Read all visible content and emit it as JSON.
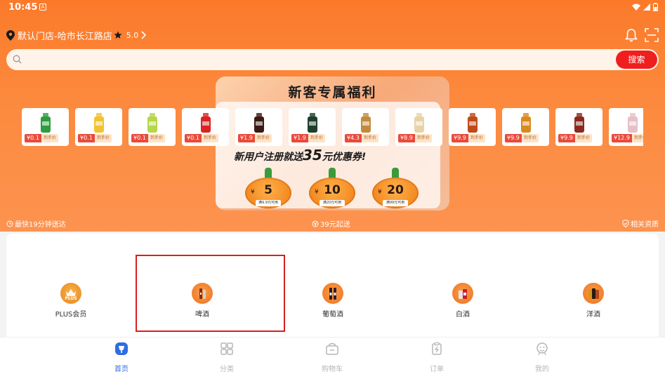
{
  "status_bar": {
    "time": "10:45",
    "notif_icon": "A"
  },
  "header": {
    "store_name": "默认门店-哈市长江路店",
    "rating": "5.0"
  },
  "search": {
    "placeholder": "",
    "button_label": "搜索"
  },
  "promo": {
    "title": "新客专属福利",
    "subtitle_prefix": "新用户注册就送",
    "subtitle_amount": "35",
    "subtitle_suffix": "元优惠券!",
    "coupons": [
      {
        "amount": "5",
        "condition": "满9.9元可用"
      },
      {
        "amount": "10",
        "condition": "满20元可用"
      },
      {
        "amount": "20",
        "condition": "满99元可用"
      }
    ]
  },
  "products": [
    {
      "price": "¥0.1",
      "tag": "到手价",
      "color": "#2e9c3f"
    },
    {
      "price": "¥0.1",
      "tag": "到手价",
      "color": "#f2c230"
    },
    {
      "price": "¥0.1",
      "tag": "到手价",
      "color": "#b7d64a"
    },
    {
      "price": "¥0.1",
      "tag": "到手价",
      "color": "#d92424"
    },
    {
      "price": "¥1.9",
      "tag": "到手价",
      "color": "#3a1a12"
    },
    {
      "price": "¥1.9",
      "tag": "到手价",
      "color": "#1f3f2a"
    },
    {
      "price": "¥4.3",
      "tag": "到手价",
      "color": "#c48a3c"
    },
    {
      "price": "¥8.9",
      "tag": "到手价",
      "color": "#e8d3a8"
    },
    {
      "price": "¥9.9",
      "tag": "到手价",
      "color": "#c14a1a"
    },
    {
      "price": "¥9.9",
      "tag": "到手价",
      "color": "#d98a1e"
    },
    {
      "price": "¥9.9",
      "tag": "到手价",
      "color": "#8a2a1e"
    },
    {
      "price": "¥12.9",
      "tag": "到手价",
      "color": "#e6c0c8"
    }
  ],
  "info": {
    "delivery": "最快19分钟送达",
    "min_order": "39元起送",
    "qualification": "相关资质"
  },
  "categories": [
    {
      "label": "PLUS会员",
      "icon_text": "PLUS"
    },
    {
      "label": "啤酒"
    },
    {
      "label": "葡萄酒"
    },
    {
      "label": "白酒"
    },
    {
      "label": "洋酒"
    }
  ],
  "nav": {
    "home": "首页",
    "category": "分类",
    "cart": "购物车",
    "orders": "订单",
    "mine": "我的"
  },
  "colors": {
    "accent": "#fb7a2a",
    "search_btn": "#f01f1f",
    "nav_active": "#2f6de0"
  }
}
